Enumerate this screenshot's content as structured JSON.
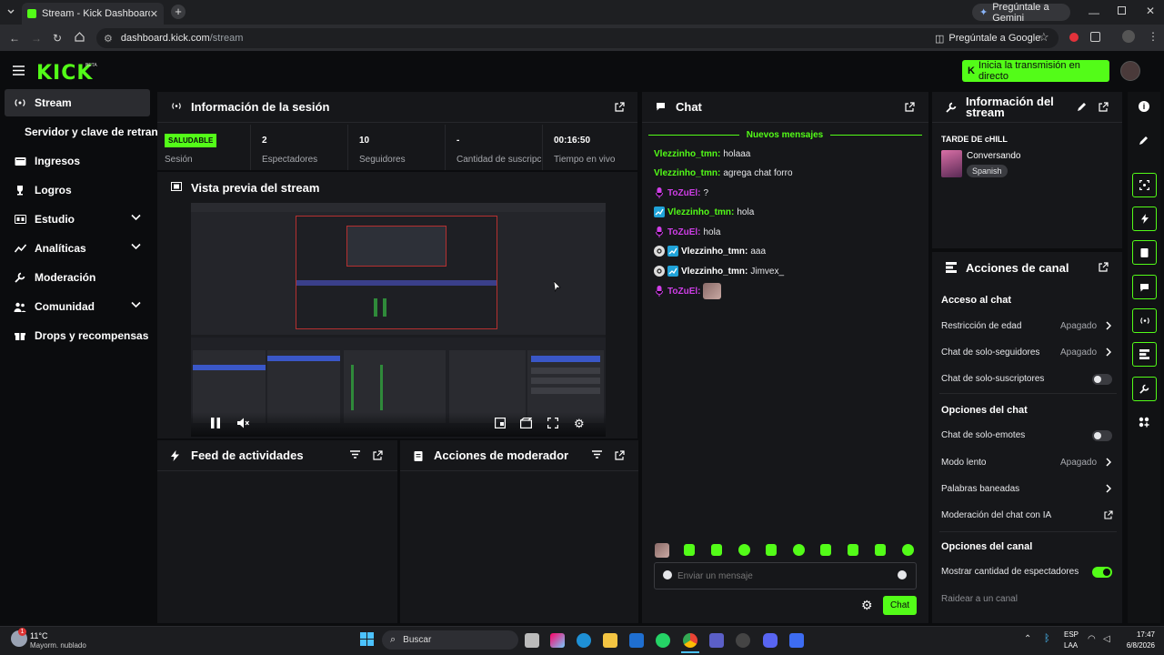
{
  "browser": {
    "tab_title": "Stream - Kick Dashboard",
    "gemini_label": "Pregúntale a Gemini",
    "url_domain": "dashboard.kick.com",
    "url_path": "/stream",
    "google_label": "Pregúntale a Google"
  },
  "topbar": {
    "logo": "KICK",
    "logo_badge": "BETA",
    "go_live_label": "Inicia la transmisión en directo"
  },
  "sidebar": {
    "items": [
      {
        "label": "Stream",
        "icon": "broadcast-icon",
        "active": true
      },
      {
        "label": "Servidor y clave de retransmisión",
        "icon": ""
      },
      {
        "label": "Ingresos",
        "icon": "wallet-icon"
      },
      {
        "label": "Logros",
        "icon": "trophy-icon"
      },
      {
        "label": "Estudio",
        "icon": "studio-icon"
      },
      {
        "label": "Analíticas",
        "icon": "analytics-icon"
      },
      {
        "label": "Moderación",
        "icon": "wrench-icon"
      },
      {
        "label": "Comunidad",
        "icon": "community-icon"
      },
      {
        "label": "Drops y recompensas",
        "icon": "drops-icon"
      }
    ]
  },
  "session": {
    "title": "Información de la sesión",
    "status_badge": "SALUDABLE",
    "status_label": "Sesión",
    "stats": [
      {
        "value": "2",
        "label": "Espectadores"
      },
      {
        "value": "10",
        "label": "Seguidores"
      },
      {
        "value": "-",
        "label": "Cantidad de suscripciones"
      },
      {
        "value": "00:16:50",
        "label": "Tiempo en vivo"
      }
    ]
  },
  "preview": {
    "title": "Vista previa del stream"
  },
  "activity": {
    "title": "Feed de actividades"
  },
  "modactions": {
    "title": "Acciones de moderador"
  },
  "chat": {
    "title": "Chat",
    "new_messages": "Nuevos mensajes",
    "messages": [
      {
        "user": "Vlezzinho_tmn:",
        "text": "holaaa",
        "badges": []
      },
      {
        "user": "Vlezzinho_tmn:",
        "text": "agrega chat forro",
        "badges": []
      },
      {
        "user": "ToZuEl:",
        "text": "?",
        "badges": [
          "mic"
        ]
      },
      {
        "user": "Vlezzinho_tmn:",
        "text": "hola",
        "badges": [
          "blue"
        ]
      },
      {
        "user": "ToZuEl:",
        "text": "hola",
        "badges": [
          "mic"
        ]
      },
      {
        "user": "Vlezzinho_tmn:",
        "text": "aaa",
        "badges": [
          "gear",
          "blue"
        ]
      },
      {
        "user": "Vlezzinho_tmn:",
        "text": "Jimvex_",
        "badges": [
          "gear",
          "blue"
        ]
      },
      {
        "user": "ToZuEl:",
        "text": "",
        "badges": [
          "mic"
        ],
        "emote": true
      }
    ],
    "input_placeholder": "Enviar un mensaje",
    "send_label": "Chat"
  },
  "stream_info": {
    "title": "Información del stream",
    "stream_title": "TARDE DE cHILL",
    "category": "Conversando",
    "language": "Spanish"
  },
  "channel_actions": {
    "title": "Acciones de canal",
    "sections": {
      "chat_access": "Acceso al chat",
      "chat_options": "Opciones del chat",
      "channel_options": "Opciones del canal"
    },
    "rows": {
      "age": {
        "label": "Restricción de edad",
        "value": "Apagado"
      },
      "followers": {
        "label": "Chat de solo-seguidores",
        "value": "Apagado"
      },
      "subs": {
        "label": "Chat de solo-suscriptores",
        "on": false
      },
      "emotes": {
        "label": "Chat de solo-emotes",
        "on": false
      },
      "slow": {
        "label": "Modo lento",
        "value": "Apagado"
      },
      "banned": {
        "label": "Palabras baneadas"
      },
      "ai_mod": {
        "label": "Moderación del chat con IA"
      },
      "viewer_count": {
        "label": "Mostrar cantidad de espectadores",
        "on": true
      },
      "raid": {
        "label": "Raidear a un canal"
      }
    }
  },
  "taskbar": {
    "weather_temp": "11°C",
    "weather_desc": "Mayorm. nublado",
    "weather_badge": "1",
    "search_placeholder": "Buscar",
    "lang_line1": "ESP",
    "lang_line2": "LAA",
    "time": "17:47",
    "date": "6/8/2026"
  },
  "colors": {
    "accent": "#53fc18",
    "panel": "#16171a",
    "bg": "#0b0c0e"
  }
}
